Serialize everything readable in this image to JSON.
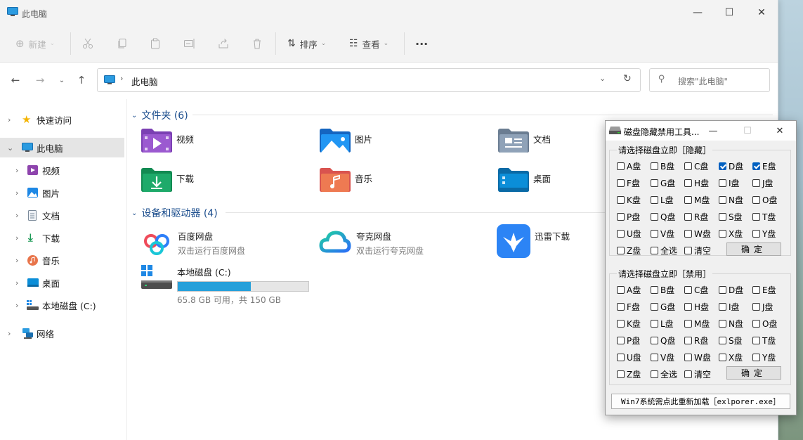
{
  "explorer": {
    "title": "此电脑",
    "toolbar": {
      "new_label": "新建",
      "sort_label": "排序",
      "view_label": "查看",
      "more_label": "···"
    },
    "address": {
      "path": "此电脑",
      "search_placeholder": "搜索\"此电脑\""
    },
    "sidebar": {
      "items": [
        {
          "label": "快速访问",
          "icon": "star-icon"
        },
        {
          "label": "此电脑",
          "icon": "computer-icon"
        },
        {
          "label": "视频",
          "icon": "video-icon"
        },
        {
          "label": "图片",
          "icon": "picture-icon"
        },
        {
          "label": "文档",
          "icon": "document-icon"
        },
        {
          "label": "下载",
          "icon": "download-icon"
        },
        {
          "label": "音乐",
          "icon": "music-icon"
        },
        {
          "label": "桌面",
          "icon": "desktop-icon"
        },
        {
          "label": "本地磁盘 (C:)",
          "icon": "drive-icon"
        },
        {
          "label": "网络",
          "icon": "network-icon"
        }
      ]
    },
    "folders_section": {
      "header": "文件夹 (6)",
      "items": [
        "视频",
        "图片",
        "文档",
        "下载",
        "音乐",
        "桌面"
      ]
    },
    "devices_section": {
      "header": "设备和驱动器 (4)",
      "items": [
        {
          "name": "百度网盘",
          "sub": "双击运行百度网盘"
        },
        {
          "name": "夸克网盘",
          "sub": "双击运行夸克网盘"
        },
        {
          "name": "迅雷下载",
          "sub": ""
        }
      ],
      "drive": {
        "name": "本地磁盘 (C:)",
        "sub": "65.8 GB 可用，共 150 GB",
        "used_fraction": 0.56
      }
    }
  },
  "dialog": {
    "title": "磁盘隐藏禁用工具...",
    "hide_group": {
      "label": "请选择磁盘立即［隐藏］",
      "checked": [
        "D盘",
        "E盘"
      ]
    },
    "disable_group": {
      "label": "请选择磁盘立即［禁用］",
      "checked": []
    },
    "drives": [
      "A盘",
      "B盘",
      "C盘",
      "D盘",
      "E盘",
      "F盘",
      "G盘",
      "H盘",
      "I盘",
      "J盘",
      "K盘",
      "L盘",
      "M盘",
      "N盘",
      "O盘",
      "P盘",
      "Q盘",
      "R盘",
      "S盘",
      "T盘",
      "U盘",
      "V盘",
      "W盘",
      "X盘",
      "Y盘",
      "Z盘"
    ],
    "select_all": "全选",
    "clear": "清空",
    "ok_label": "确定",
    "reload_label": "Win7系統需点此重新加载［exlporer.exe］"
  }
}
